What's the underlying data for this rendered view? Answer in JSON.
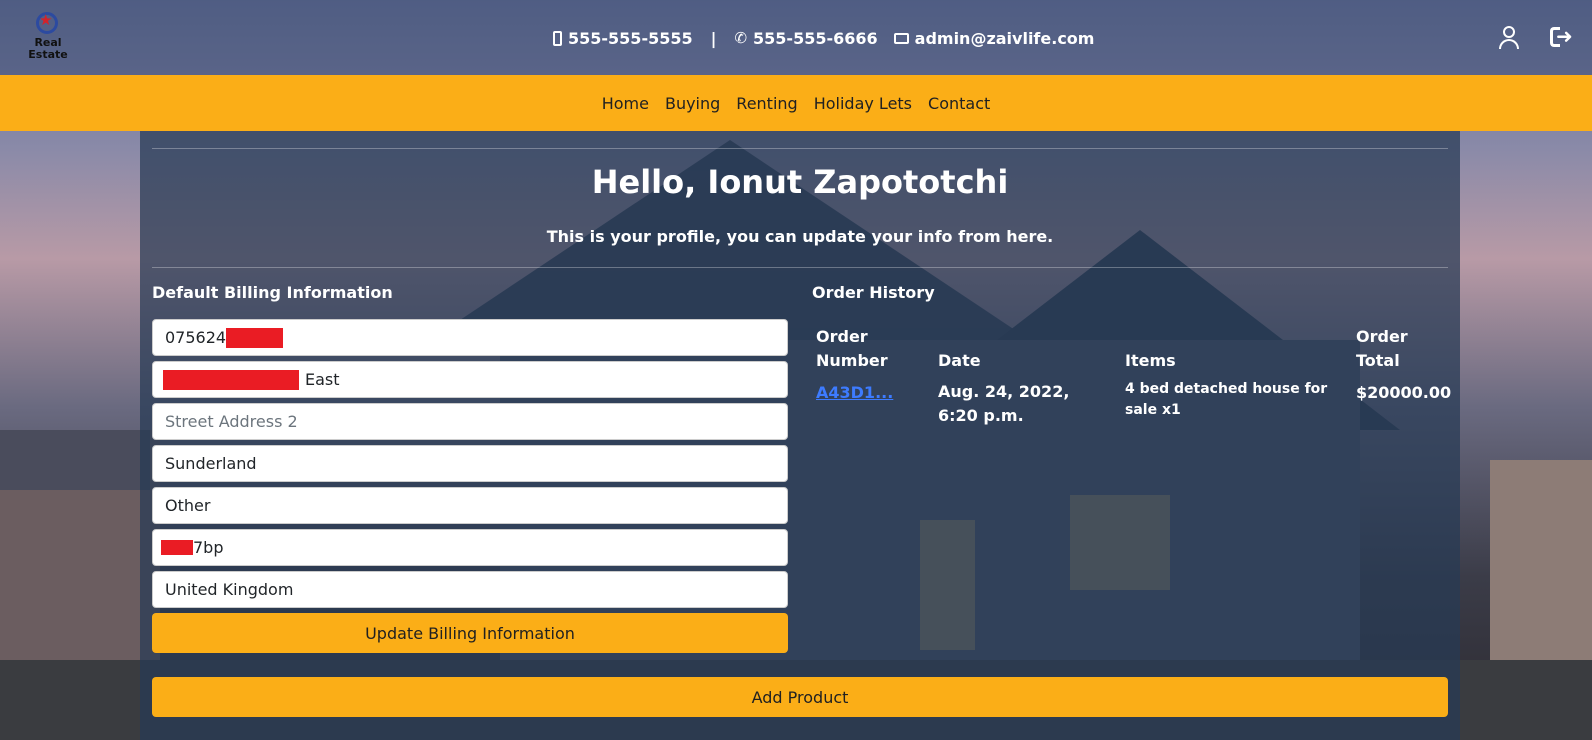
{
  "header": {
    "logo_line1": "Real",
    "logo_line2": "Estate",
    "mobile": "555-555-5555",
    "separator": "|",
    "phone": "555-555-6666",
    "email": "admin@zaivlife.com",
    "icons": [
      "mobile-icon",
      "phone-icon",
      "mail-icon",
      "user-icon",
      "logout-icon"
    ]
  },
  "nav": {
    "items": [
      "Home",
      "Buying",
      "Renting",
      "Holiday Lets",
      "Contact"
    ]
  },
  "profile": {
    "greeting": "Hello, Ionut Zapototchi",
    "subtitle": "This is your profile, you can update your info from here."
  },
  "billing": {
    "heading": "Default Billing Information",
    "phone_value": "075624",
    "street1_value": "East",
    "street2_placeholder": "Street Address 2",
    "city_value": "Sunderland",
    "county_value": "Other",
    "postcode_value": "7bp",
    "country_value": "United Kingdom",
    "update_button": "Update Billing Information"
  },
  "orders": {
    "heading": "Order History",
    "columns": {
      "number": "Order Number",
      "date": "Date",
      "items": "Items",
      "total": "Order Total"
    },
    "rows": [
      {
        "number": "A43D1...",
        "date": "Aug. 24, 2022, 6:20 p.m.",
        "items": "4 bed detached house for sale x1",
        "total": "$20000.00"
      }
    ]
  },
  "add_product_button": "Add Product",
  "colors": {
    "accent": "#fbae17",
    "panel": "#273a54",
    "redaction": "#ea1c24",
    "link": "#3d7bff"
  }
}
